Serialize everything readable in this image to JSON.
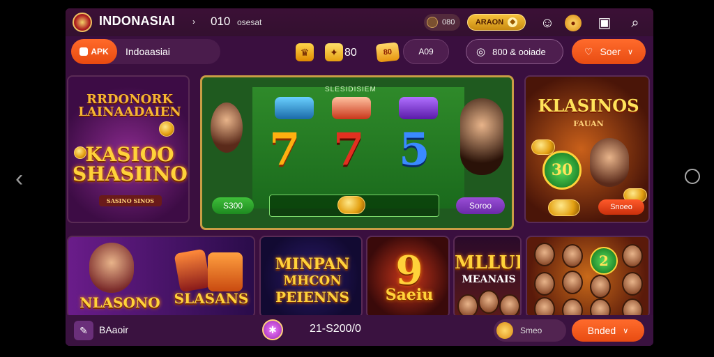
{
  "header": {
    "brand": "INDONASIAI",
    "chevron": "›",
    "count": "010",
    "label": "osesat",
    "coin_value": "080",
    "gold_badge": "ARAON",
    "icons": [
      "user-icon",
      "coin-icon",
      "grid-icon",
      "search-icon"
    ]
  },
  "subbar": {
    "apk_label": "APK",
    "apk_text": "Indoaasiai",
    "mid_number": "80",
    "chip_label": "80",
    "ao_label": "A09",
    "outline_pill": "800 & ooiade",
    "orange_pill": "Soer"
  },
  "tiles": {
    "t1": {
      "top_title": "RRDONORK LAINAADAIEN",
      "main": "KASIOO SHASIINO",
      "sub": "SASINO SINOS"
    },
    "t2": {
      "reel_title": "SLESIDISIEM",
      "left_btn": "S300",
      "right_btn": "Soroo",
      "symbols": [
        "7",
        "7",
        "5"
      ]
    },
    "t3": {
      "main": "KLASINOS",
      "sub": "FAUAN",
      "badge": "30",
      "btn": "Snoeo"
    },
    "t4": {
      "left": "NLASONO",
      "right": "SLASANS"
    },
    "t5": {
      "a": "MINPAN",
      "b": "MHCON",
      "c": "PEIENNS"
    },
    "t6": {
      "a": "9",
      "b": "Saeiu"
    },
    "t7": {
      "a": "MLLUP",
      "b": "MEANAIS"
    },
    "t8": {
      "badge": "2"
    }
  },
  "bottombar": {
    "left": "BAaoir",
    "mid": "21-S200/0",
    "pill": "Smeo",
    "button": "Bnded"
  },
  "colors": {
    "background": "#3a0f3f",
    "accent_orange": "#e84c12",
    "gold": "#f6c23c"
  }
}
